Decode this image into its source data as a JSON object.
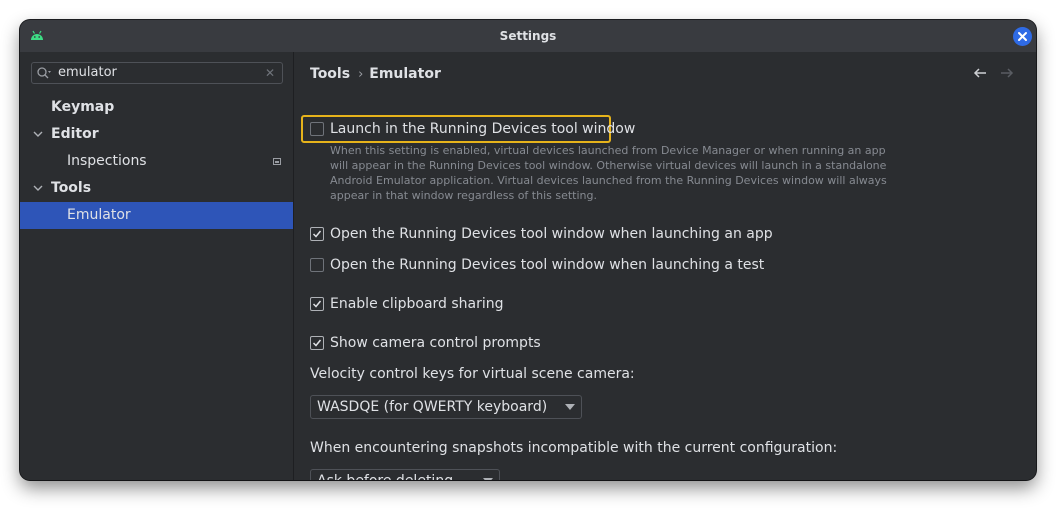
{
  "window": {
    "title": "Settings",
    "app_icon": "android-icon",
    "close_icon": "close-icon",
    "accent_color": "#2f6be6"
  },
  "sidebar": {
    "search": {
      "value": "emulator",
      "icon": "search-icon",
      "clear_icon": "clear-icon"
    },
    "items": [
      {
        "label": "Keymap",
        "expanded": null
      },
      {
        "label": "Editor",
        "expanded": true
      },
      {
        "label": "Inspections",
        "badge_icon": "project-scope-icon"
      },
      {
        "label": "Tools",
        "expanded": true
      },
      {
        "label": "Emulator",
        "selected": true
      }
    ],
    "selection_color": "#2e55b8"
  },
  "content": {
    "breadcrumb": {
      "parent": "Tools",
      "separator": "›",
      "current": "Emulator"
    },
    "nav": {
      "back_icon": "arrow-left-icon",
      "forward_icon": "arrow-right-icon"
    },
    "launch_option": {
      "label": "Launch in the Running Devices tool window",
      "checked": false,
      "highlight_color": "#e6b31b",
      "description": "When this setting is enabled, virtual devices launched from Device Manager or when running an app will appear in the Running Devices tool window. Otherwise virtual devices will launch in a standalone Android Emulator application. Virtual devices launched from the Running Devices window will always appear in that window regardless of this setting."
    },
    "options": [
      {
        "label": "Open the Running Devices tool window when launching an app",
        "checked": true
      },
      {
        "label": "Open the Running Devices tool window when launching a test",
        "checked": false
      },
      {
        "label": "Enable clipboard sharing",
        "checked": true
      },
      {
        "label": "Show camera control prompts",
        "checked": true
      }
    ],
    "velocity": {
      "label": "Velocity control keys for virtual scene camera:",
      "value": "WASDQE (for QWERTY keyboard)"
    },
    "snapshots": {
      "label": "When encountering snapshots incompatible with the current configuration:",
      "value": "Ask before deleting"
    }
  }
}
